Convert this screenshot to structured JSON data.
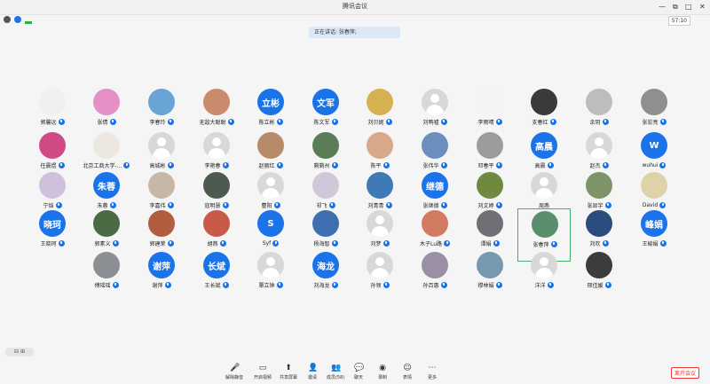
{
  "window": {
    "title": "腾讯会议",
    "controls": [
      "—",
      "⧉",
      "□",
      "✕"
    ]
  },
  "subbar": {
    "timer": "57:10"
  },
  "speaking": "正在讲话: 张春萍;",
  "participants": [
    {
      "name": "郭馨远",
      "avatar": "photo",
      "color": "#f0f0f0",
      "mic": true
    },
    {
      "name": "张倩",
      "avatar": "photo",
      "color": "#e58fc5",
      "mic": true
    },
    {
      "name": "李春玲",
      "avatar": "photo",
      "color": "#6aa3d6",
      "mic": true
    },
    {
      "name": "无敌大聪聪",
      "avatar": "photo",
      "color": "#c98b6c",
      "mic": true
    },
    {
      "name": "陈立彬",
      "avatar": "text",
      "text": "立彬",
      "mic": true
    },
    {
      "name": "陈文军",
      "avatar": "text",
      "text": "文军",
      "mic": true
    },
    {
      "name": "刘贝妮",
      "avatar": "photo",
      "color": "#d5b14f",
      "mic": true
    },
    {
      "name": "刘鸭嘘",
      "avatar": "default",
      "mic": true
    },
    {
      "name": "李雨晴",
      "avatar": "photo",
      "color": "#f4f4f4",
      "mic": true
    },
    {
      "name": "支春红",
      "avatar": "photo",
      "color": "#3a3a3a",
      "mic": true
    },
    {
      "name": "余玥",
      "avatar": "photo",
      "color": "#bdbdbd",
      "mic": true
    },
    {
      "name": "张宏亮",
      "avatar": "photo",
      "color": "#8f8f8f",
      "mic": true
    },
    {
      "name": "任晨煜",
      "avatar": "photo",
      "color": "#d04b86",
      "mic": true
    },
    {
      "name": "北京工商大学-...",
      "avatar": "photo",
      "color": "#ece8df",
      "mic": true
    },
    {
      "name": "高城彬",
      "avatar": "default",
      "mic": true
    },
    {
      "name": "李艳春",
      "avatar": "default",
      "mic": true
    },
    {
      "name": "赵丽红",
      "avatar": "photo",
      "color": "#b78a6a",
      "mic": true
    },
    {
      "name": "剩剩州",
      "avatar": "photo",
      "color": "#5a7c56",
      "mic": true
    },
    {
      "name": "陈平",
      "avatar": "photo",
      "color": "#d8a88a",
      "mic": true
    },
    {
      "name": "张伟华",
      "avatar": "photo",
      "color": "#6c8ebd",
      "mic": true
    },
    {
      "name": "邓春平",
      "avatar": "photo",
      "color": "#9c9c9c",
      "mic": true
    },
    {
      "name": "高晨",
      "avatar": "text",
      "text": "高晨",
      "mic": true
    },
    {
      "name": "赵杰",
      "avatar": "default",
      "mic": true
    },
    {
      "name": "wuhui",
      "avatar": "text",
      "text": "W",
      "mic": true
    },
    {
      "name": "宁焰",
      "avatar": "photo",
      "color": "#cfc0dc",
      "mic": true
    },
    {
      "name": "朱蓉",
      "avatar": "text",
      "text": "朱蓉",
      "mic": true
    },
    {
      "name": "李嘉伟",
      "avatar": "photo",
      "color": "#c7b7a7",
      "mic": true
    },
    {
      "name": "寇明慧",
      "avatar": "photo",
      "color": "#4d5a4f",
      "mic": true
    },
    {
      "name": "曹阳",
      "avatar": "default",
      "mic": true
    },
    {
      "name": "祁飞",
      "avatar": "photo",
      "color": "#cfc8d8",
      "mic": true
    },
    {
      "name": "刘青青",
      "avatar": "photo",
      "color": "#3f7ab6",
      "mic": true
    },
    {
      "name": "张继德",
      "avatar": "text",
      "text": "继德",
      "mic": true
    },
    {
      "name": "刘文婷",
      "avatar": "photo",
      "color": "#6f8a3e",
      "mic": true
    },
    {
      "name": "周燕",
      "avatar": "default",
      "mic": false
    },
    {
      "name": "张显宇",
      "avatar": "photo",
      "color": "#7d9468",
      "mic": true
    },
    {
      "name": "David",
      "avatar": "photo",
      "color": "#e0d2a8",
      "mic": true
    },
    {
      "name": "王晓珂",
      "avatar": "text",
      "text": "晓珂",
      "mic": true
    },
    {
      "name": "郭素义",
      "avatar": "photo",
      "color": "#4b6b45",
      "mic": true
    },
    {
      "name": "郭建荣",
      "avatar": "photo",
      "color": "#b25d3f",
      "mic": true
    },
    {
      "name": "胡燕",
      "avatar": "photo",
      "color": "#c95a4a",
      "mic": true
    },
    {
      "name": "Syf",
      "avatar": "text",
      "text": "S",
      "mic": true
    },
    {
      "name": "杨海智",
      "avatar": "photo",
      "color": "#3e6fb1",
      "mic": true
    },
    {
      "name": "刘梦",
      "avatar": "default",
      "mic": true
    },
    {
      "name": "木子Lu路",
      "avatar": "photo",
      "color": "#d27b62",
      "mic": true
    },
    {
      "name": "谭娟",
      "avatar": "photo",
      "color": "#6e7075",
      "mic": true
    },
    {
      "name": "张春萍",
      "avatar": "photo",
      "color": "#5a8f6d",
      "mic": true,
      "highlight": true
    },
    {
      "name": "刘欢",
      "avatar": "photo",
      "color": "#2b4d7e",
      "mic": true
    },
    {
      "name": "王峻娟",
      "avatar": "text",
      "text": "峰娟",
      "mic": true
    },
    {
      "name": "傅瑶瑶",
      "avatar": "photo",
      "color": "#8b8f93",
      "mic": true
    },
    {
      "name": "谢萍",
      "avatar": "text",
      "text": "谢萍",
      "mic": true
    },
    {
      "name": "王长斌",
      "avatar": "text",
      "text": "长斌",
      "mic": true
    },
    {
      "name": "覃立钟",
      "avatar": "default",
      "mic": true
    },
    {
      "name": "刘海龙",
      "avatar": "text",
      "text": "海龙",
      "mic": true
    },
    {
      "name": "孙领",
      "avatar": "default",
      "mic": true
    },
    {
      "name": "孙百惠",
      "avatar": "photo",
      "color": "#9a8fa3",
      "mic": true
    },
    {
      "name": "穆林娟",
      "avatar": "photo",
      "color": "#7799b0",
      "mic": true
    },
    {
      "name": "洋洋",
      "avatar": "default",
      "mic": true
    },
    {
      "name": "邢佳媛",
      "avatar": "photo",
      "color": "#3c3c3c",
      "mic": true
    }
  ],
  "toolbar": [
    {
      "label": "解除静音",
      "icon": "🎤",
      "color": "#d33"
    },
    {
      "label": "开启视频",
      "icon": "▭",
      "color": "#333"
    },
    {
      "label": "共享屏幕",
      "icon": "⬆",
      "color": "#333"
    },
    {
      "label": "邀请",
      "icon": "👤",
      "color": "#333"
    },
    {
      "label": "成员(58)",
      "icon": "👥",
      "color": "#333"
    },
    {
      "label": "聊天",
      "icon": "💬",
      "color": "#333"
    },
    {
      "label": "录制",
      "icon": "◉",
      "color": "#333"
    },
    {
      "label": "表情",
      "icon": "☺",
      "color": "#333"
    },
    {
      "label": "更多",
      "icon": "⋯",
      "color": "#333"
    }
  ],
  "leave_button": "离开会议"
}
